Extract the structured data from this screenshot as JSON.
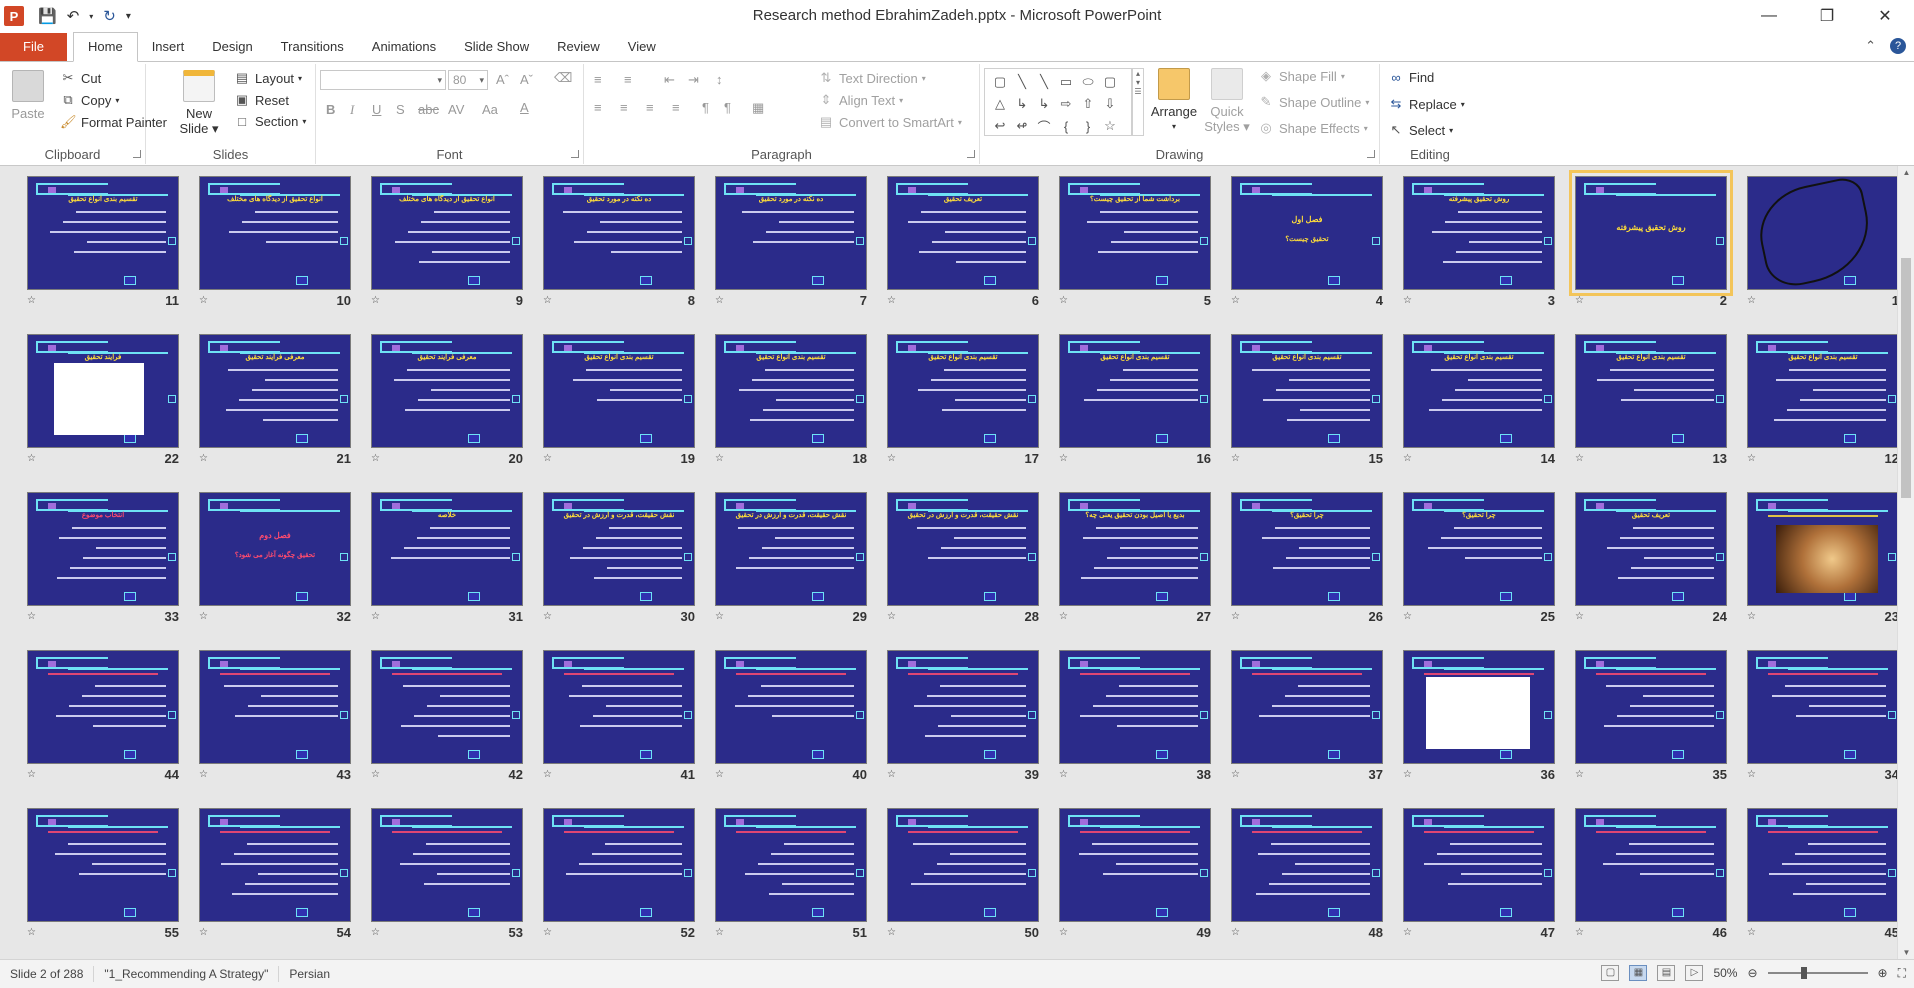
{
  "window": {
    "title": "Research method EbrahimZadeh.pptx - Microsoft PowerPoint",
    "app_logo": "P"
  },
  "tabs": [
    "File",
    "Home",
    "Insert",
    "Design",
    "Transitions",
    "Animations",
    "Slide Show",
    "Review",
    "View"
  ],
  "ribbon": {
    "clipboard": {
      "paste": "Paste",
      "cut": "Cut",
      "copy": "Copy",
      "format_painter": "Format Painter",
      "label": "Clipboard"
    },
    "slides": {
      "new_slide": "New",
      "new_slide_2": "Slide",
      "layout": "Layout",
      "reset": "Reset",
      "section": "Section",
      "label": "Slides"
    },
    "font": {
      "font_size": "80",
      "label": "Font"
    },
    "paragraph": {
      "text_direction": "Text Direction",
      "align_text": "Align Text",
      "smartart": "Convert to SmartArt",
      "label": "Paragraph"
    },
    "drawing": {
      "arrange": "Arrange",
      "quick_styles": "Quick",
      "quick_styles_2": "Styles",
      "shape_fill": "Shape Fill",
      "shape_outline": "Shape Outline",
      "shape_effects": "Shape Effects",
      "label": "Drawing"
    },
    "editing": {
      "find": "Find",
      "replace": "Replace",
      "select": "Select",
      "label": "Editing"
    }
  },
  "slides": [
    {
      "num": "1",
      "title": "",
      "title_color": "yellow",
      "kind": "calligraphy"
    },
    {
      "num": "2",
      "title": "روش تحقیق پیشرفته",
      "title_color": "yellow",
      "kind": "cover",
      "selected": true
    },
    {
      "num": "3",
      "title": "روش تحقیق پیشرفته",
      "title_color": "yellow",
      "kind": "text"
    },
    {
      "num": "4",
      "title": "فصل اول",
      "subtitle": "تحقیق چیست؟",
      "title_color": "yellow",
      "kind": "center"
    },
    {
      "num": "5",
      "title": "برداشت شما از تحقیق چیست؟",
      "title_color": "yellow",
      "kind": "text"
    },
    {
      "num": "6",
      "title": "تعریف تحقیق",
      "title_color": "yellow",
      "kind": "text"
    },
    {
      "num": "7",
      "title": "ده نکته در مورد تحقیق",
      "title_color": "yellow",
      "kind": "text"
    },
    {
      "num": "8",
      "title": "ده نکته در مورد تحقیق",
      "title_color": "yellow",
      "kind": "text"
    },
    {
      "num": "9",
      "title": "انواع تحقیق از دیدگاه های مختلف",
      "title_color": "yellow",
      "kind": "text"
    },
    {
      "num": "10",
      "title": "انواع تحقیق از دیدگاه های مختلف",
      "title_color": "yellow",
      "kind": "text"
    },
    {
      "num": "11",
      "title": "تقسیم بندی انواع تحقیق",
      "title_color": "yellow",
      "kind": "text"
    },
    {
      "num": "12",
      "title": "تقسیم بندی انواع تحقیق",
      "title_color": "yellow",
      "kind": "text"
    },
    {
      "num": "13",
      "title": "تقسیم بندی انواع تحقیق",
      "title_color": "yellow",
      "kind": "text"
    },
    {
      "num": "14",
      "title": "تقسیم بندی انواع تحقیق",
      "title_color": "yellow",
      "kind": "text"
    },
    {
      "num": "15",
      "title": "تقسیم بندی انواع تحقیق",
      "title_color": "yellow",
      "kind": "text"
    },
    {
      "num": "16",
      "title": "تقسیم بندی انواع تحقیق",
      "title_color": "yellow",
      "kind": "text"
    },
    {
      "num": "17",
      "title": "تقسیم بندی انواع تحقیق",
      "title_color": "yellow",
      "kind": "text"
    },
    {
      "num": "18",
      "title": "تقسیم بندی انواع تحقیق",
      "title_color": "yellow",
      "kind": "text"
    },
    {
      "num": "19",
      "title": "تقسیم بندی انواع تحقیق",
      "title_color": "yellow",
      "kind": "text"
    },
    {
      "num": "20",
      "title": "معرفی فرایند تحقیق",
      "title_color": "yellow",
      "kind": "text"
    },
    {
      "num": "21",
      "title": "معرفی فرایند تحقیق",
      "title_color": "yellow",
      "kind": "text"
    },
    {
      "num": "22",
      "title": "فرایند تحقیق",
      "title_color": "yellow",
      "kind": "diagram"
    },
    {
      "num": "23",
      "title": "",
      "title_color": "yellow",
      "kind": "photo"
    },
    {
      "num": "24",
      "title": "تعریف تحقیق",
      "title_color": "yellow",
      "kind": "text"
    },
    {
      "num": "25",
      "title": "چرا تحقیق؟",
      "title_color": "yellow",
      "kind": "text"
    },
    {
      "num": "26",
      "title": "چرا تحقیق؟",
      "title_color": "yellow",
      "kind": "text"
    },
    {
      "num": "27",
      "title": "بدیع یا اصیل بودن تحقیق یعنی چه؟",
      "title_color": "yellow",
      "kind": "text"
    },
    {
      "num": "28",
      "title": "نقش حقیقت، قدرت و ارزش در تحقیق",
      "title_color": "yellow",
      "kind": "text"
    },
    {
      "num": "29",
      "title": "نقش حقیقت، قدرت و ارزش در تحقیق",
      "title_color": "yellow",
      "kind": "text"
    },
    {
      "num": "30",
      "title": "نقش حقیقت، قدرت و ارزش در تحقیق",
      "title_color": "yellow",
      "kind": "text"
    },
    {
      "num": "31",
      "title": "خلاصه",
      "title_color": "yellow",
      "kind": "text"
    },
    {
      "num": "32",
      "title": "فصل دوم",
      "subtitle": "تحقیق چگونه آغاز می شود؟",
      "title_color": "red",
      "kind": "center"
    },
    {
      "num": "33",
      "title": "انتخاب موضوع",
      "title_color": "red",
      "kind": "text"
    },
    {
      "num": "34",
      "title": "",
      "title_color": "red",
      "kind": "text"
    },
    {
      "num": "35",
      "title": "",
      "title_color": "red",
      "kind": "text"
    },
    {
      "num": "36",
      "title": "",
      "title_color": "red",
      "kind": "diagram2"
    },
    {
      "num": "37",
      "title": "",
      "title_color": "red",
      "kind": "text"
    },
    {
      "num": "38",
      "title": "",
      "title_color": "red",
      "kind": "text"
    },
    {
      "num": "39",
      "title": "",
      "title_color": "red",
      "kind": "text"
    },
    {
      "num": "40",
      "title": "",
      "title_color": "red",
      "kind": "text"
    },
    {
      "num": "41",
      "title": "",
      "title_color": "red",
      "kind": "text"
    },
    {
      "num": "42",
      "title": "",
      "title_color": "red",
      "kind": "text"
    },
    {
      "num": "43",
      "title": "",
      "title_color": "red",
      "kind": "text"
    },
    {
      "num": "44",
      "title": "",
      "title_color": "red",
      "kind": "text"
    },
    {
      "num": "45",
      "title": "",
      "title_color": "red",
      "kind": "text"
    },
    {
      "num": "46",
      "title": "",
      "title_color": "red",
      "kind": "text"
    },
    {
      "num": "47",
      "title": "",
      "title_color": "red",
      "kind": "text"
    },
    {
      "num": "48",
      "title": "",
      "title_color": "red",
      "kind": "text"
    },
    {
      "num": "49",
      "title": "",
      "title_color": "red",
      "kind": "text"
    },
    {
      "num": "50",
      "title": "",
      "title_color": "red",
      "kind": "text"
    },
    {
      "num": "51",
      "title": "",
      "title_color": "red",
      "kind": "text"
    },
    {
      "num": "52",
      "title": "",
      "title_color": "red",
      "kind": "text"
    },
    {
      "num": "53",
      "title": "",
      "title_color": "red",
      "kind": "text"
    },
    {
      "num": "54",
      "title": "",
      "title_color": "red",
      "kind": "text"
    },
    {
      "num": "55",
      "title": "",
      "title_color": "red",
      "kind": "text"
    }
  ],
  "status": {
    "slide_info": "Slide 2 of 288",
    "theme": "\"1_Recommending A Strategy\"",
    "language": "Persian",
    "zoom": "50%"
  },
  "colors": {
    "slide_bg": "#2b2b8a",
    "accent_cyan": "#6ee2f5",
    "title_yellow": "#ffde3a",
    "title_red": "#ff4b6e",
    "file_tab": "#d24726",
    "selection": "#f3c55a"
  }
}
